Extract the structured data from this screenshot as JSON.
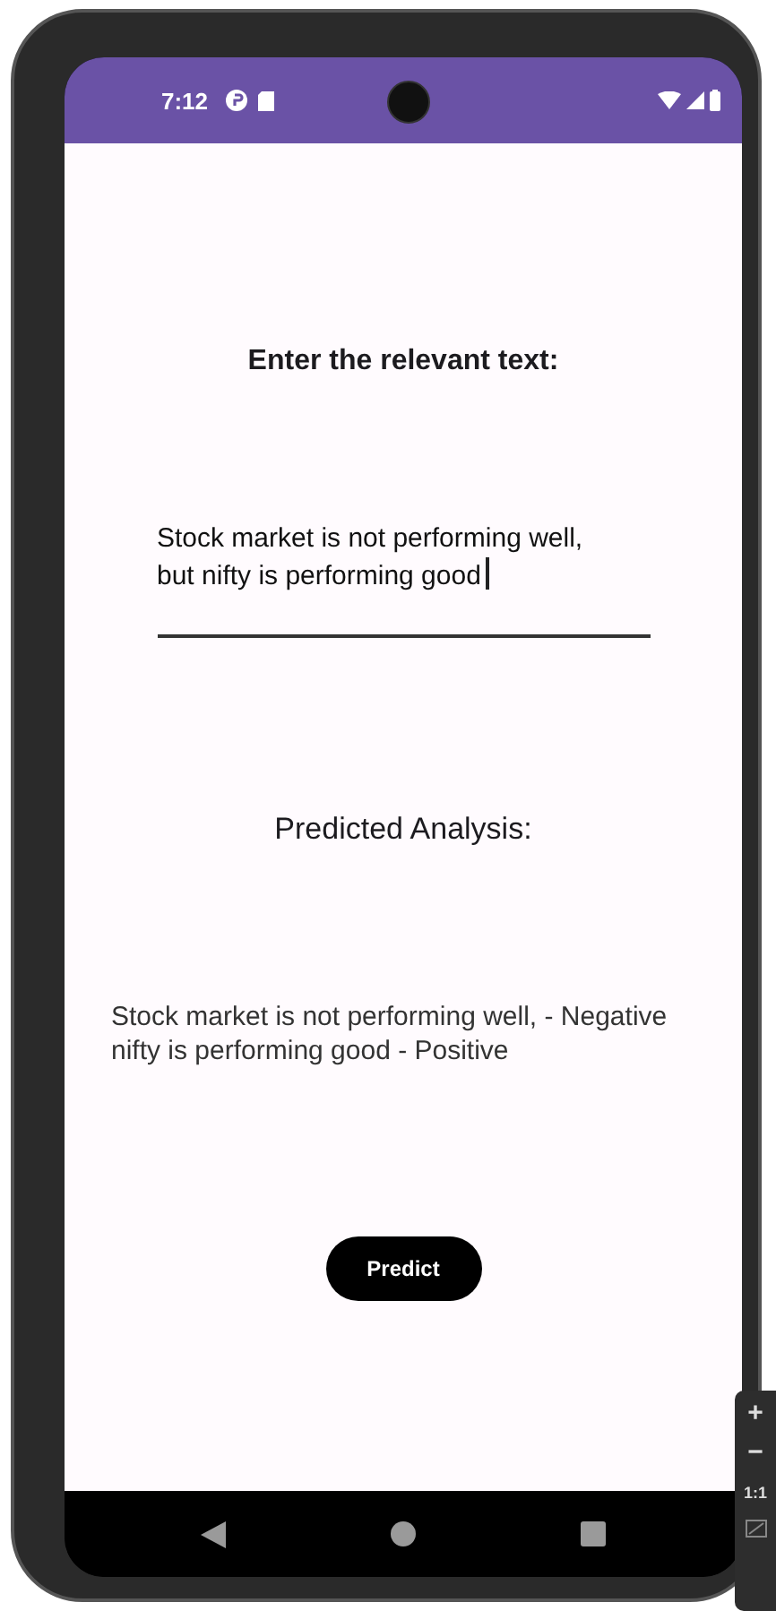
{
  "status_bar": {
    "time": "7:12"
  },
  "prompt": "Enter the relevant text:",
  "input": {
    "value": "Stock market is not performing well, but nifty is performing good",
    "focused": true
  },
  "result_title": "Predicted Analysis:",
  "result_lines": [
    "Stock market is not performing well, - Negative",
    "nifty is performing good - Positive"
  ],
  "predict_button": "Predict",
  "zoom_controls": [
    "+",
    "−",
    "1:1"
  ]
}
